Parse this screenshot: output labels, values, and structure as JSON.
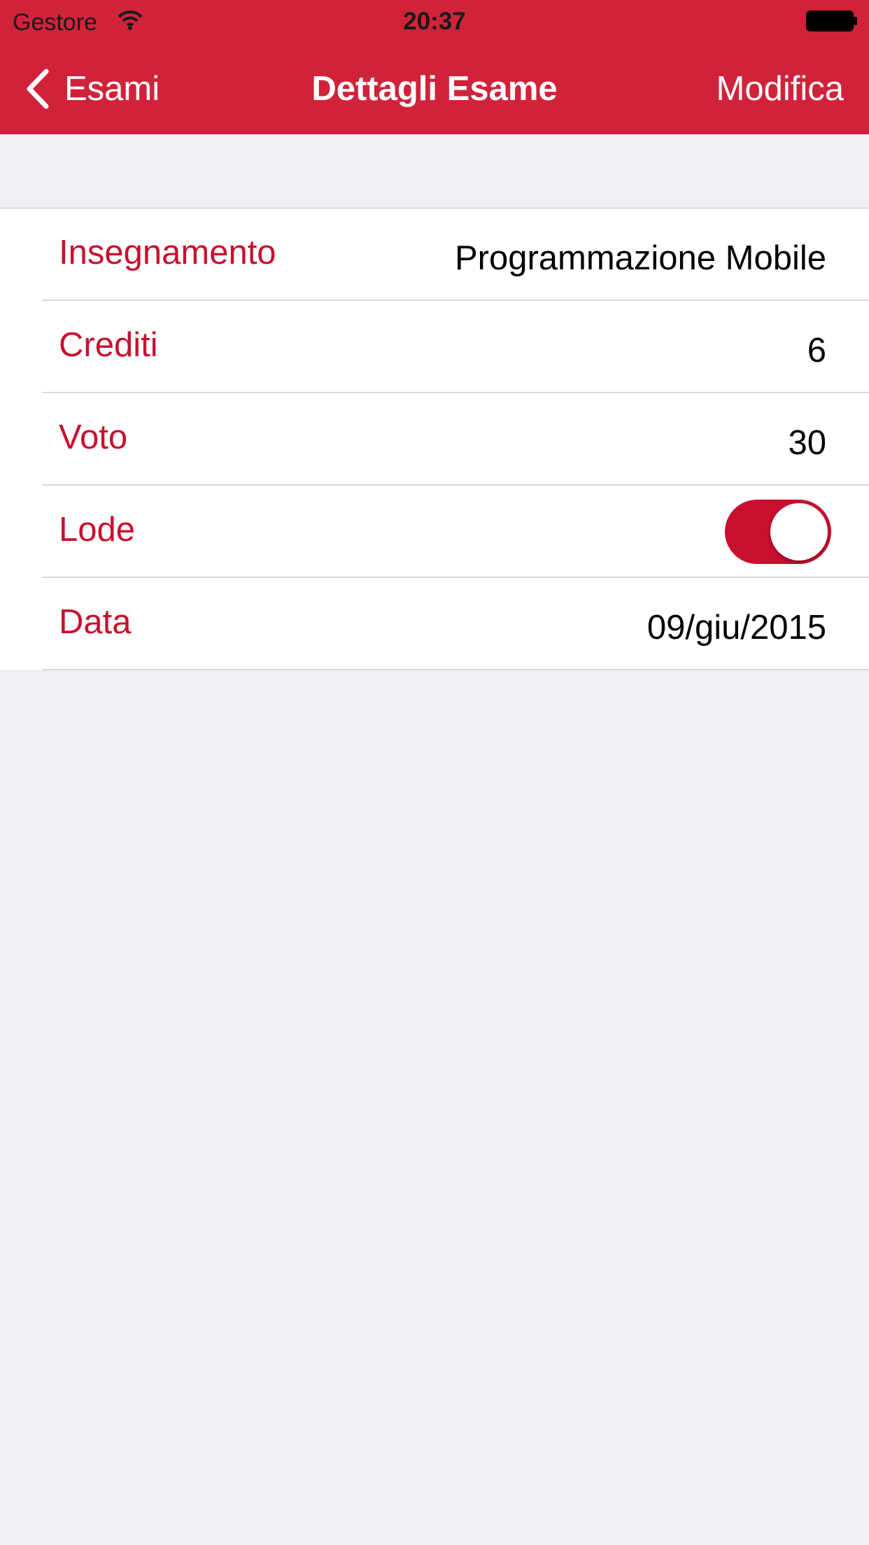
{
  "status_bar": {
    "carrier": "Gestore",
    "time": "20:37"
  },
  "nav": {
    "back_label": "Esami",
    "title": "Dettagli Esame",
    "edit_label": "Modifica"
  },
  "details": [
    {
      "label": "Insegnamento",
      "value": "Programmazione Mobile"
    },
    {
      "label": "Crediti",
      "value": "6"
    },
    {
      "label": "Voto",
      "value": "30"
    },
    {
      "label": "Lode",
      "value": null
    },
    {
      "label": "Data",
      "value": "09/giu/2015"
    }
  ],
  "lode_toggle": {
    "on": true
  },
  "colors": {
    "nav_bg": "#d0233a",
    "label": "#c8102e",
    "toggle_on": "#c8102e",
    "page_bg": "#efeff4"
  }
}
